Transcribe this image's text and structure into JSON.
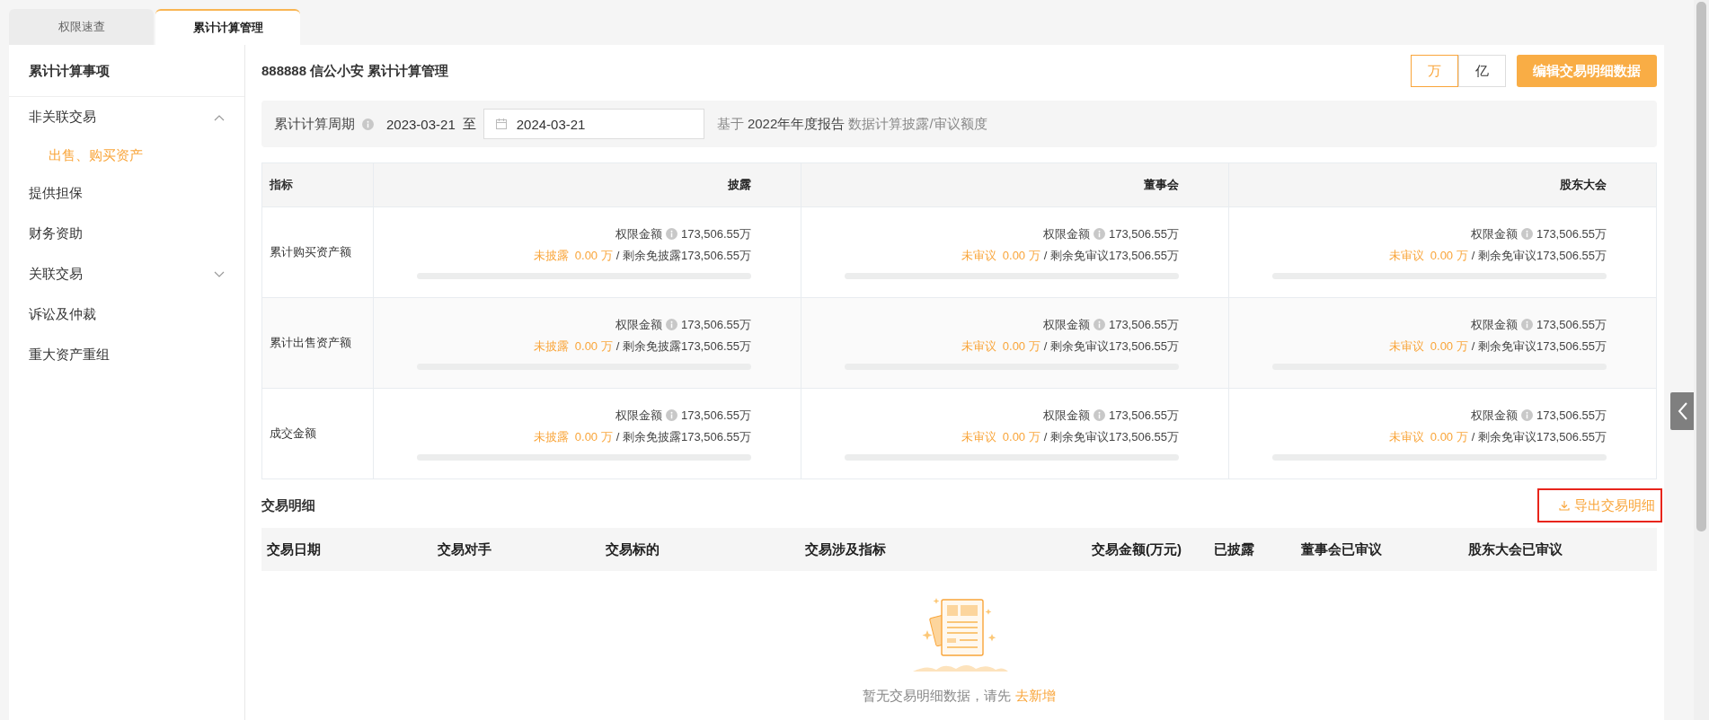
{
  "tabs": [
    {
      "label": "权限速查",
      "selected": false
    },
    {
      "label": "累计计算管理",
      "selected": true
    }
  ],
  "sidebar": {
    "title": "累计计算事项",
    "items": [
      {
        "label": "非关联交易",
        "selected": false,
        "expanded": true,
        "children": [
          {
            "label": "出售、购买资产",
            "selected": true
          }
        ]
      },
      {
        "label": "提供担保",
        "selected": false
      },
      {
        "label": "财务资助",
        "selected": false
      },
      {
        "label": "关联交易",
        "selected": false,
        "expanded": false
      },
      {
        "label": "诉讼及仲裁",
        "selected": false
      },
      {
        "label": "重大资产重组",
        "selected": false
      }
    ]
  },
  "page_title": "888888 信公小安 累计计算管理",
  "unit_toggle": [
    {
      "label": "万",
      "selected": true
    },
    {
      "label": "亿",
      "selected": false
    }
  ],
  "edit_button": "编辑交易明细数据",
  "period": {
    "label": "累计计算周期",
    "start": "2023-03-21",
    "separator": "至",
    "end": "2024-03-21",
    "basis_prefix": "基于",
    "basis_report": "2022年年度报告",
    "basis_suffix": "数据计算披露/审议额度"
  },
  "limits_table": {
    "columns": {
      "indicator": "指标",
      "disclosure": "披露",
      "board": "董事会",
      "shareholders": "股东大会"
    },
    "rows": [
      {
        "indicator": "累计购买资产额",
        "disclosure": {
          "limit_label": "权限金额",
          "limit_value": "173,506.55万",
          "pending": "未披露  0.00 万",
          "remaining": "/ 剩余免披露173,506.55万"
        },
        "board": {
          "limit_label": "权限金额",
          "limit_value": "173,506.55万",
          "pending": "未审议  0.00 万",
          "remaining": "/ 剩余免审议173,506.55万"
        },
        "shareholders": {
          "limit_label": "权限金额",
          "limit_value": "173,506.55万",
          "pending": "未审议  0.00 万",
          "remaining": "/ 剩余免审议173,506.55万"
        }
      },
      {
        "indicator": "累计出售资产额",
        "disclosure": {
          "limit_label": "权限金额",
          "limit_value": "173,506.55万",
          "pending": "未披露  0.00 万",
          "remaining": "/ 剩余免披露173,506.55万"
        },
        "board": {
          "limit_label": "权限金额",
          "limit_value": "173,506.55万",
          "pending": "未审议  0.00 万",
          "remaining": "/ 剩余免审议173,506.55万"
        },
        "shareholders": {
          "limit_label": "权限金额",
          "limit_value": "173,506.55万",
          "pending": "未审议  0.00 万",
          "remaining": "/ 剩余免审议173,506.55万"
        }
      },
      {
        "indicator": "成交金额",
        "disclosure": {
          "limit_label": "权限金额",
          "limit_value": "173,506.55万",
          "pending": "未披露  0.00 万",
          "remaining": "/ 剩余免披露173,506.55万"
        },
        "board": {
          "limit_label": "权限金额",
          "limit_value": "173,506.55万",
          "pending": "未审议  0.00 万",
          "remaining": "/ 剩余免审议173,506.55万"
        },
        "shareholders": {
          "limit_label": "权限金额",
          "limit_value": "173,506.55万",
          "pending": "未审议  0.00 万",
          "remaining": "/ 剩余免审议173,506.55万"
        }
      }
    ]
  },
  "details": {
    "title": "交易明细",
    "export_button": "导出交易明细",
    "columns": [
      "交易日期",
      "交易对手",
      "交易标的",
      "交易涉及指标",
      "交易金额(万元)",
      "已披露",
      "董事会已审议",
      "股东大会已审议"
    ],
    "empty_text": "暂无交易明细数据，请先",
    "empty_link": "去新增"
  }
}
